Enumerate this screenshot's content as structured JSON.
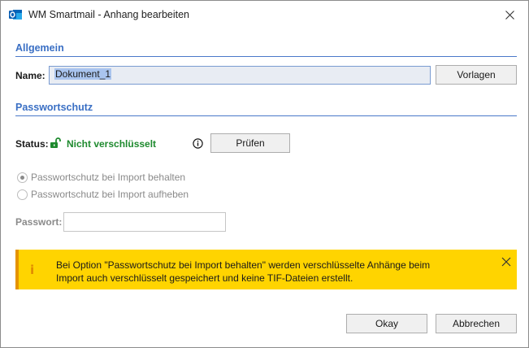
{
  "window": {
    "title": "WM Smartmail - Anhang bearbeiten",
    "close_glyph": "✕"
  },
  "general": {
    "header": "Allgemein",
    "name_label": "Name:",
    "name_value": "Dokument_1",
    "templates_button": "Vorlagen"
  },
  "password_protection": {
    "header": "Passwortschutz",
    "status_label": "Status:",
    "status_value": "Nicht verschlüsselt",
    "check_button": "Prüfen",
    "options": [
      {
        "label": "Passwortschutz bei Import behalten",
        "selected": true
      },
      {
        "label": "Passwortschutz bei Import aufheben",
        "selected": false
      }
    ],
    "password_label": "Passwort:",
    "password_value": ""
  },
  "banner": {
    "icon": "i",
    "line1": "Bei Option \"Passwortschutz bei Import behalten\" werden verschlüsselte Anhänge beim",
    "line2": "Import auch verschlüsselt gespeichert und keine TIF-Dateien erstellt."
  },
  "footer": {
    "okay_button": "Okay",
    "cancel_button": "Abbrechen"
  },
  "colors": {
    "accent": "#3a6fc4",
    "status_ok": "#1e8a2e",
    "banner_bg": "#ffd400",
    "banner_icon": "#e08a00"
  },
  "icons": {
    "app": "outlook-app-icon",
    "lock": "unlocked-padlock-icon",
    "info": "info-circle-icon",
    "close": "close-icon"
  }
}
